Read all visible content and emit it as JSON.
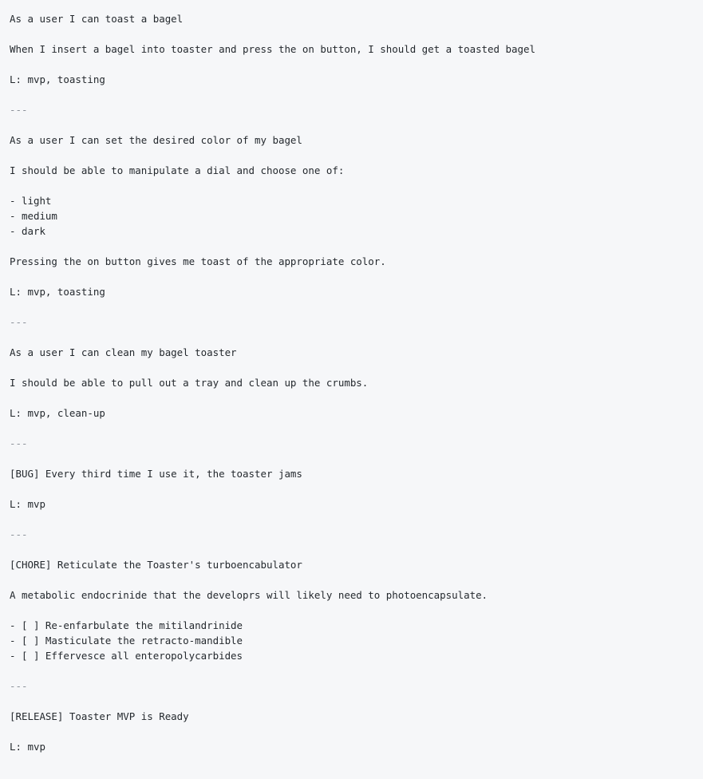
{
  "document": {
    "background_color": "#f6f7f9",
    "text_color": "#24292e",
    "rule_color": "#8b9199",
    "separator": "---",
    "blocks": [
      {
        "id": "story-toast-bagel-title",
        "type": "paragraph",
        "text": "As a user I can toast a bagel"
      },
      {
        "id": "story-toast-bagel-body",
        "type": "paragraph",
        "text": "When I insert a bagel into toaster and press the on button, I should get a toasted bagel"
      },
      {
        "id": "story-toast-bagel-labels",
        "type": "paragraph",
        "text": "L: mvp, toasting"
      },
      {
        "id": "separator-1",
        "type": "separator",
        "text": "---"
      },
      {
        "id": "story-color-title",
        "type": "paragraph",
        "text": "As a user I can set the desired color of my bagel"
      },
      {
        "id": "story-color-body",
        "type": "paragraph",
        "text": "I should be able to manipulate a dial and choose one of:"
      },
      {
        "id": "story-color-options",
        "type": "list",
        "items": [
          "- light",
          "- medium",
          "- dark"
        ]
      },
      {
        "id": "story-color-outcome",
        "type": "paragraph",
        "text": "Pressing the on button gives me toast of the appropriate color."
      },
      {
        "id": "story-color-labels",
        "type": "paragraph",
        "text": "L: mvp, toasting"
      },
      {
        "id": "separator-2",
        "type": "separator",
        "text": "---"
      },
      {
        "id": "story-clean-title",
        "type": "paragraph",
        "text": "As a user I can clean my bagel toaster"
      },
      {
        "id": "story-clean-body",
        "type": "paragraph",
        "text": "I should be able to pull out a tray and clean up the crumbs."
      },
      {
        "id": "story-clean-labels",
        "type": "paragraph",
        "text": "L: mvp, clean-up"
      },
      {
        "id": "separator-3",
        "type": "separator",
        "text": "---"
      },
      {
        "id": "bug-toaster-jams-title",
        "type": "paragraph",
        "text": "[BUG] Every third time I use it, the toaster jams"
      },
      {
        "id": "bug-toaster-jams-labels",
        "type": "paragraph",
        "text": "L: mvp"
      },
      {
        "id": "separator-4",
        "type": "separator",
        "text": "---"
      },
      {
        "id": "chore-turboencabulator-title",
        "type": "paragraph",
        "text": "[CHORE] Reticulate the Toaster's turboencabulator"
      },
      {
        "id": "chore-turboencabulator-body",
        "type": "paragraph",
        "text": "A metabolic endocrinide that the developrs will likely need to photoencapsulate."
      },
      {
        "id": "chore-turboencabulator-tasks",
        "type": "list",
        "items": [
          "- [ ] Re-enfarbulate the mitilandrinide",
          "- [ ] Masticulate the retracto-mandible",
          "- [ ] Effervesce all enteropolycarbides"
        ]
      },
      {
        "id": "separator-5",
        "type": "separator",
        "text": "---"
      },
      {
        "id": "release-toaster-mvp-title",
        "type": "paragraph",
        "text": "[RELEASE] Toaster MVP is Ready"
      },
      {
        "id": "release-toaster-mvp-labels",
        "type": "paragraph",
        "text": "L: mvp"
      }
    ]
  }
}
